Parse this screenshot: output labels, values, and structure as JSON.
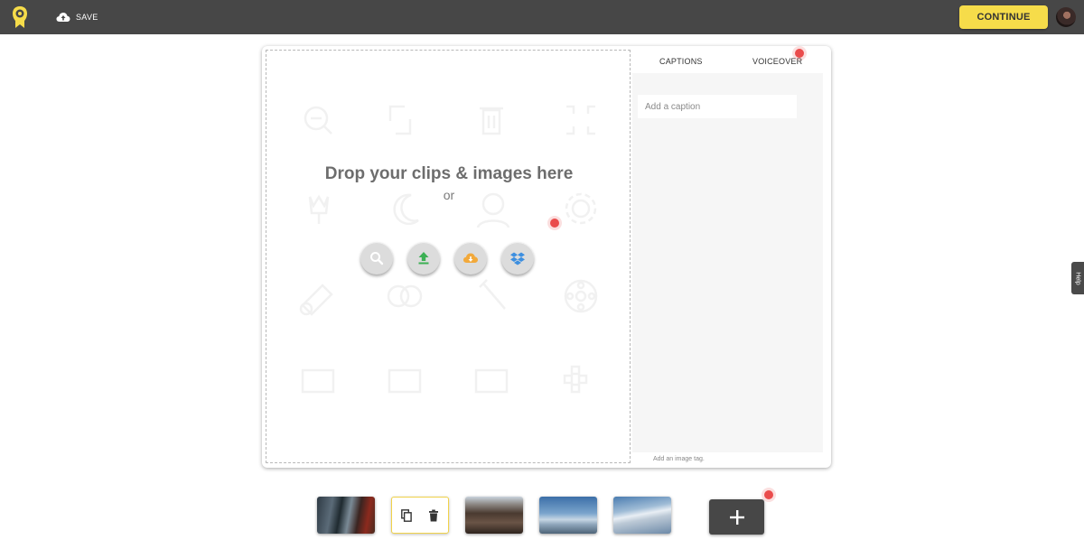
{
  "toolbar": {
    "save_label": "SAVE",
    "continue_label": "CONTINUE"
  },
  "dropzone": {
    "title": "Drop your clips & images here",
    "or_text": "or",
    "sources": [
      {
        "name": "search",
        "icon": "search-icon",
        "color": "#ffffff"
      },
      {
        "name": "upload",
        "icon": "upload-icon",
        "color": "#3cb054"
      },
      {
        "name": "cloud",
        "icon": "cloud-download-icon",
        "color": "#f2a93b"
      },
      {
        "name": "dropbox",
        "icon": "dropbox-icon",
        "color": "#3d8fe0"
      }
    ]
  },
  "panel": {
    "tabs": [
      "CAPTIONS",
      "VOICEOVER"
    ],
    "caption_placeholder": "Add a caption",
    "image_tag_text": "Add an image tag."
  },
  "help": {
    "label": "Help"
  },
  "colors": {
    "topbar": "#474747",
    "accent": "#f6dc4a",
    "hint_dot": "#ea4c4c"
  }
}
